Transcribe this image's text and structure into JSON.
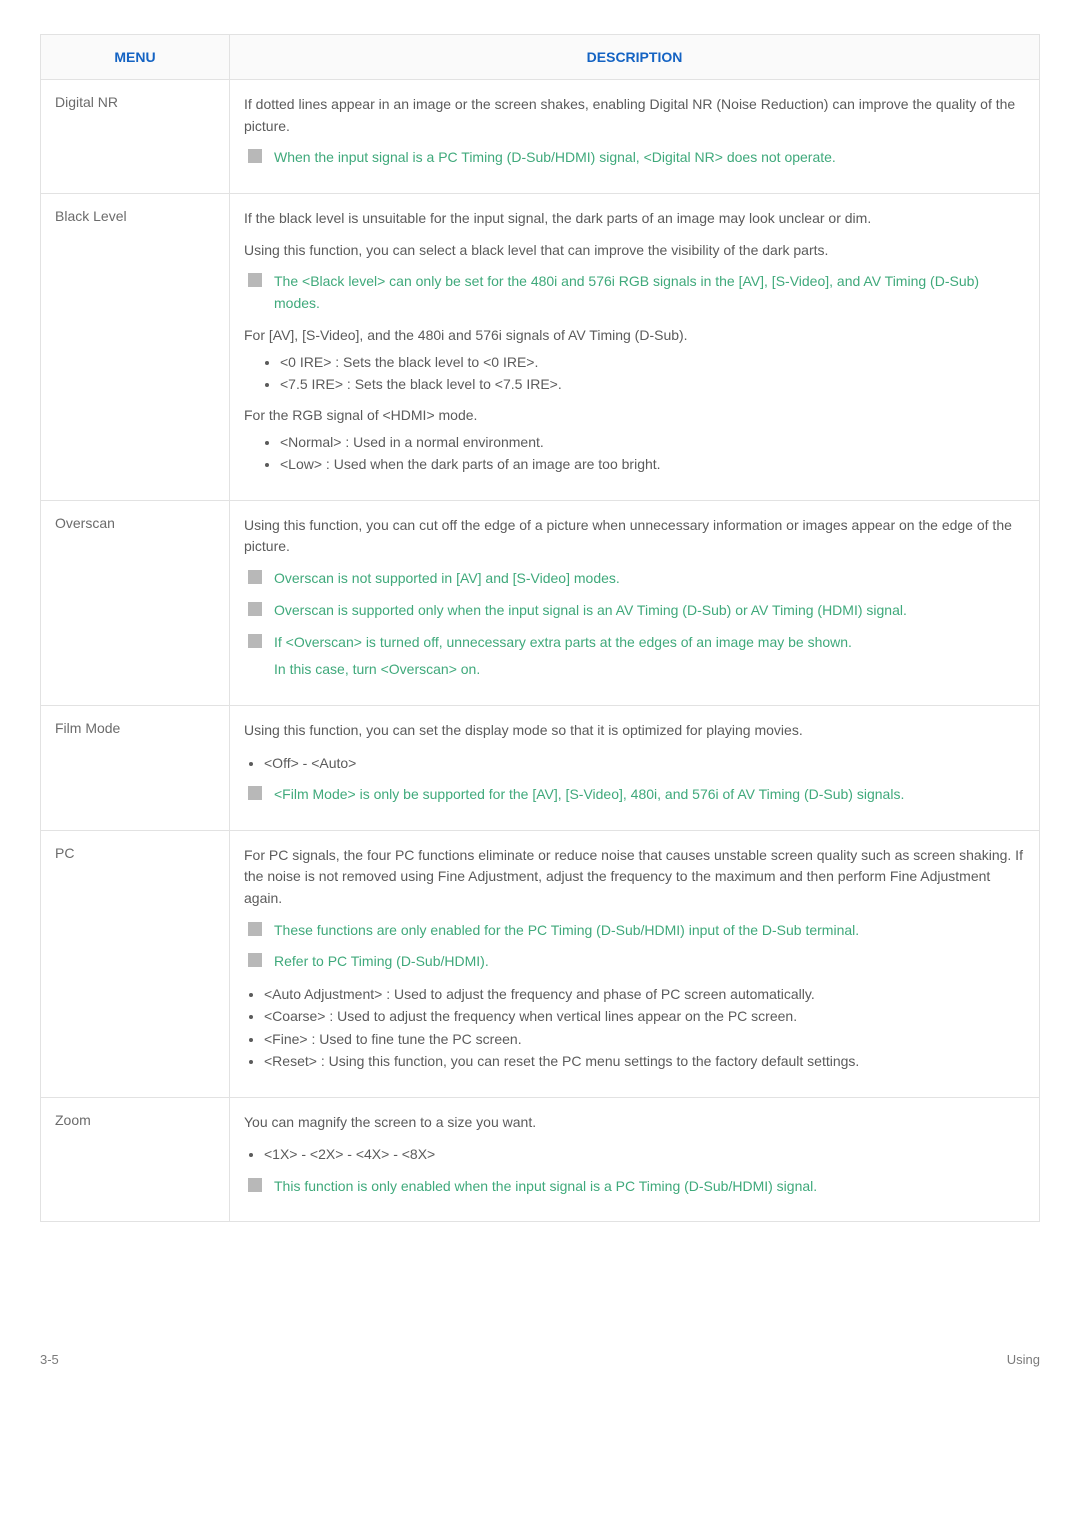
{
  "header": {
    "menu": "MENU",
    "description": "DESCRIPTION"
  },
  "rows": {
    "digital_nr": {
      "name": "Digital NR",
      "p1": "If dotted lines appear in an image or the screen shakes, enabling Digital NR (Noise Reduction) can improve the quality of the picture.",
      "note1": "When the input signal is a PC Timing (D-Sub/HDMI) signal, <Digital NR> does not operate."
    },
    "black_level": {
      "name": "Black Level",
      "p1": "If the black level is unsuitable for the input signal, the dark parts of an image may look unclear or dim.",
      "p2": "Using this function, you can select a black level that can improve the visibility of the dark parts.",
      "note1": "The <Black level> can only be set for the 480i and 576i RGB signals in the [AV], [S-Video], and AV Timing (D-Sub) modes.",
      "s1": "For [AV], [S-Video], and the 480i and 576i signals of AV Timing (D-Sub).",
      "b1": "<0 IRE> : Sets the black level to <0 IRE>.",
      "b2": "<7.5 IRE> : Sets the black level to <7.5 IRE>.",
      "s2": "For the RGB signal of <HDMI> mode.",
      "b3": "<Normal> : Used in a normal environment.",
      "b4": "<Low> : Used when the dark parts of an image are too bright."
    },
    "overscan": {
      "name": "Overscan",
      "p1": "Using this function, you can cut off the edge of a picture when unnecessary information or images appear on the edge of the picture.",
      "note1": "Overscan is not supported in [AV] and [S-Video] modes.",
      "note2": "Overscan is supported only when the input signal is an AV Timing (D-Sub) or AV Timing (HDMI) signal.",
      "note3": "If <Overscan> is turned off, unnecessary extra parts at the edges of an image may be shown.",
      "note3b": "In this case, turn <Overscan> on."
    },
    "film_mode": {
      "name": "Film Mode",
      "p1": "Using this function, you can set the display mode so that it is optimized for playing movies.",
      "b1": "<Off> - <Auto>",
      "note1": "<Film Mode> is only be supported for the [AV], [S-Video], 480i, and 576i of AV Timing (D-Sub) signals."
    },
    "pc": {
      "name": "PC",
      "p1": "For PC signals, the four PC functions eliminate or reduce noise that causes unstable screen quality such as screen shaking. If the noise is not removed using Fine Adjustment, adjust the frequency to the maximum and then perform Fine Adjustment again.",
      "note1": "These functions are only enabled for the PC Timing (D-Sub/HDMI) input of the D-Sub terminal.",
      "note2": "Refer to PC Timing (D-Sub/HDMI).",
      "b1": "<Auto Adjustment> : Used to adjust the frequency and phase of PC screen automatically.",
      "b2": "<Coarse> : Used to adjust the frequency when vertical lines appear on the PC screen.",
      "b3": "<Fine> : Used to fine tune the PC screen.",
      "b4": "<Reset> : Using this function, you can reset the PC menu settings to the factory default settings."
    },
    "zoom": {
      "name": "Zoom",
      "p1": "You can magnify the screen to a size you want.",
      "b1": "<1X> - <2X> - <4X> - <8X>",
      "note1": "This function is only enabled when the input signal is a PC Timing (D-Sub/HDMI) signal."
    }
  },
  "footer": {
    "left": "3-5",
    "right": "Using"
  }
}
